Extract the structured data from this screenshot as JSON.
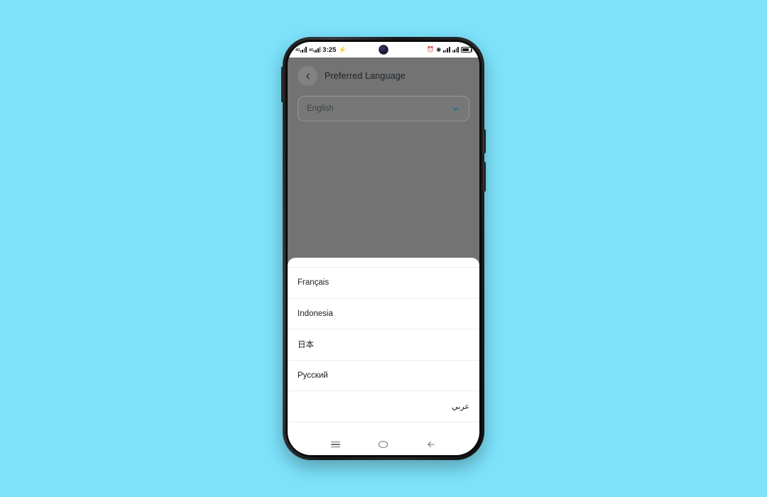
{
  "background_color": "#7de3fb",
  "device": {
    "frame_color": "#1b1b1d",
    "screen_dim_overlay": "#737373",
    "buttons": {
      "power": "power-button",
      "volume": "volume-button",
      "left": "left-side-button"
    },
    "camera": "punch-hole-camera"
  },
  "status_bar": {
    "time": "3:25",
    "network_label_1": "4G",
    "network_label_2": "4G",
    "charging_icon": "charging-bolt-icon",
    "alarm_icon": "alarm-clock-icon",
    "eye_icon": "eye-care-icon",
    "wifi_icon": "wifi-icon",
    "signal_icon": "signal-bars-icon",
    "battery_icon": "battery-icon",
    "battery_level": "80"
  },
  "header": {
    "back_label": "back-chevron",
    "title": "Preferred Language"
  },
  "language_field": {
    "value": "English",
    "chevron_color": "#0e7490",
    "chevron_icon": "chevron-down-icon"
  },
  "bottom_sheet": {
    "items": [
      {
        "label": "",
        "clipped": true,
        "rtl": false
      },
      {
        "label": "Français",
        "clipped": false,
        "rtl": false
      },
      {
        "label": "Indonesia",
        "clipped": false,
        "rtl": false
      },
      {
        "label": "日本",
        "clipped": false,
        "rtl": false
      },
      {
        "label": "Русский",
        "clipped": false,
        "rtl": false
      },
      {
        "label": "عربي",
        "clipped": false,
        "rtl": true
      }
    ]
  },
  "nav_bar": {
    "recents": "recents-icon",
    "home": "home-icon",
    "back": "back-arrow-icon"
  }
}
